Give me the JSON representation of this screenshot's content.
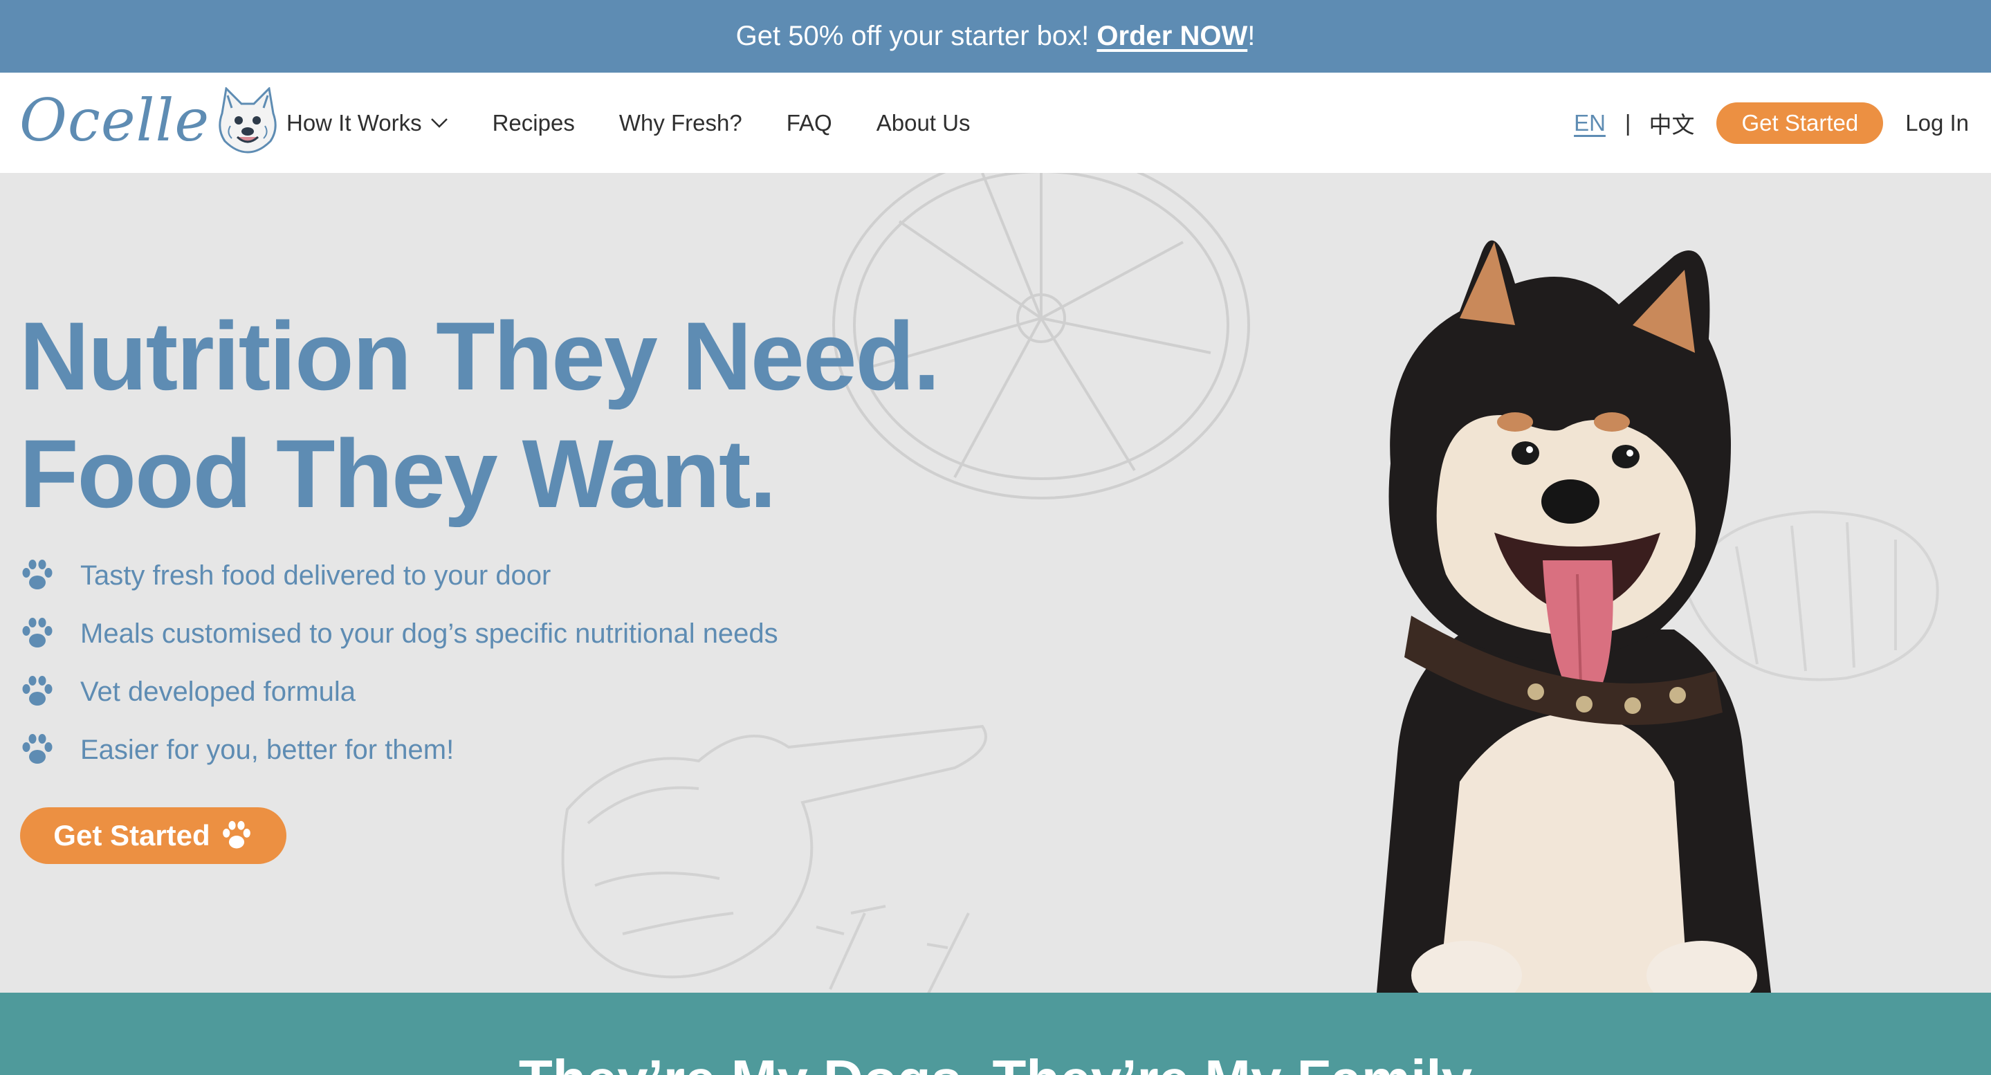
{
  "promo": {
    "text": "Get 50% off your starter box! ",
    "link": "Order NOW",
    "suffix": "!"
  },
  "nav": {
    "logo_text": "Ocelle",
    "menu": [
      {
        "label": "How It Works",
        "has_dropdown": true
      },
      {
        "label": "Recipes"
      },
      {
        "label": "Why Fresh?"
      },
      {
        "label": "FAQ"
      },
      {
        "label": "About Us"
      }
    ],
    "lang_en": "EN",
    "lang_separator": "|",
    "lang_zh": "中文",
    "cta": "Get Started",
    "login": "Log In"
  },
  "hero": {
    "headline_line1": "Nutrition They Need.",
    "headline_line2": "Food They Want.",
    "benefits": [
      "Tasty fresh food delivered to your door",
      "Meals customised to your dog’s specific nutritional needs",
      "Vet developed formula",
      "Easier for you, better for them!"
    ],
    "cta": "Get Started"
  },
  "band": {
    "title": "They’re My Dogs, They’re My Family"
  },
  "colors": {
    "brand_blue": "#5e8cb3",
    "accent_orange": "#ec9042",
    "teal": "#4f9a9b",
    "hero_bg": "#e6e6e6"
  },
  "icons": [
    "chevron-down-icon",
    "paw-icon",
    "dog-logo-icon"
  ]
}
